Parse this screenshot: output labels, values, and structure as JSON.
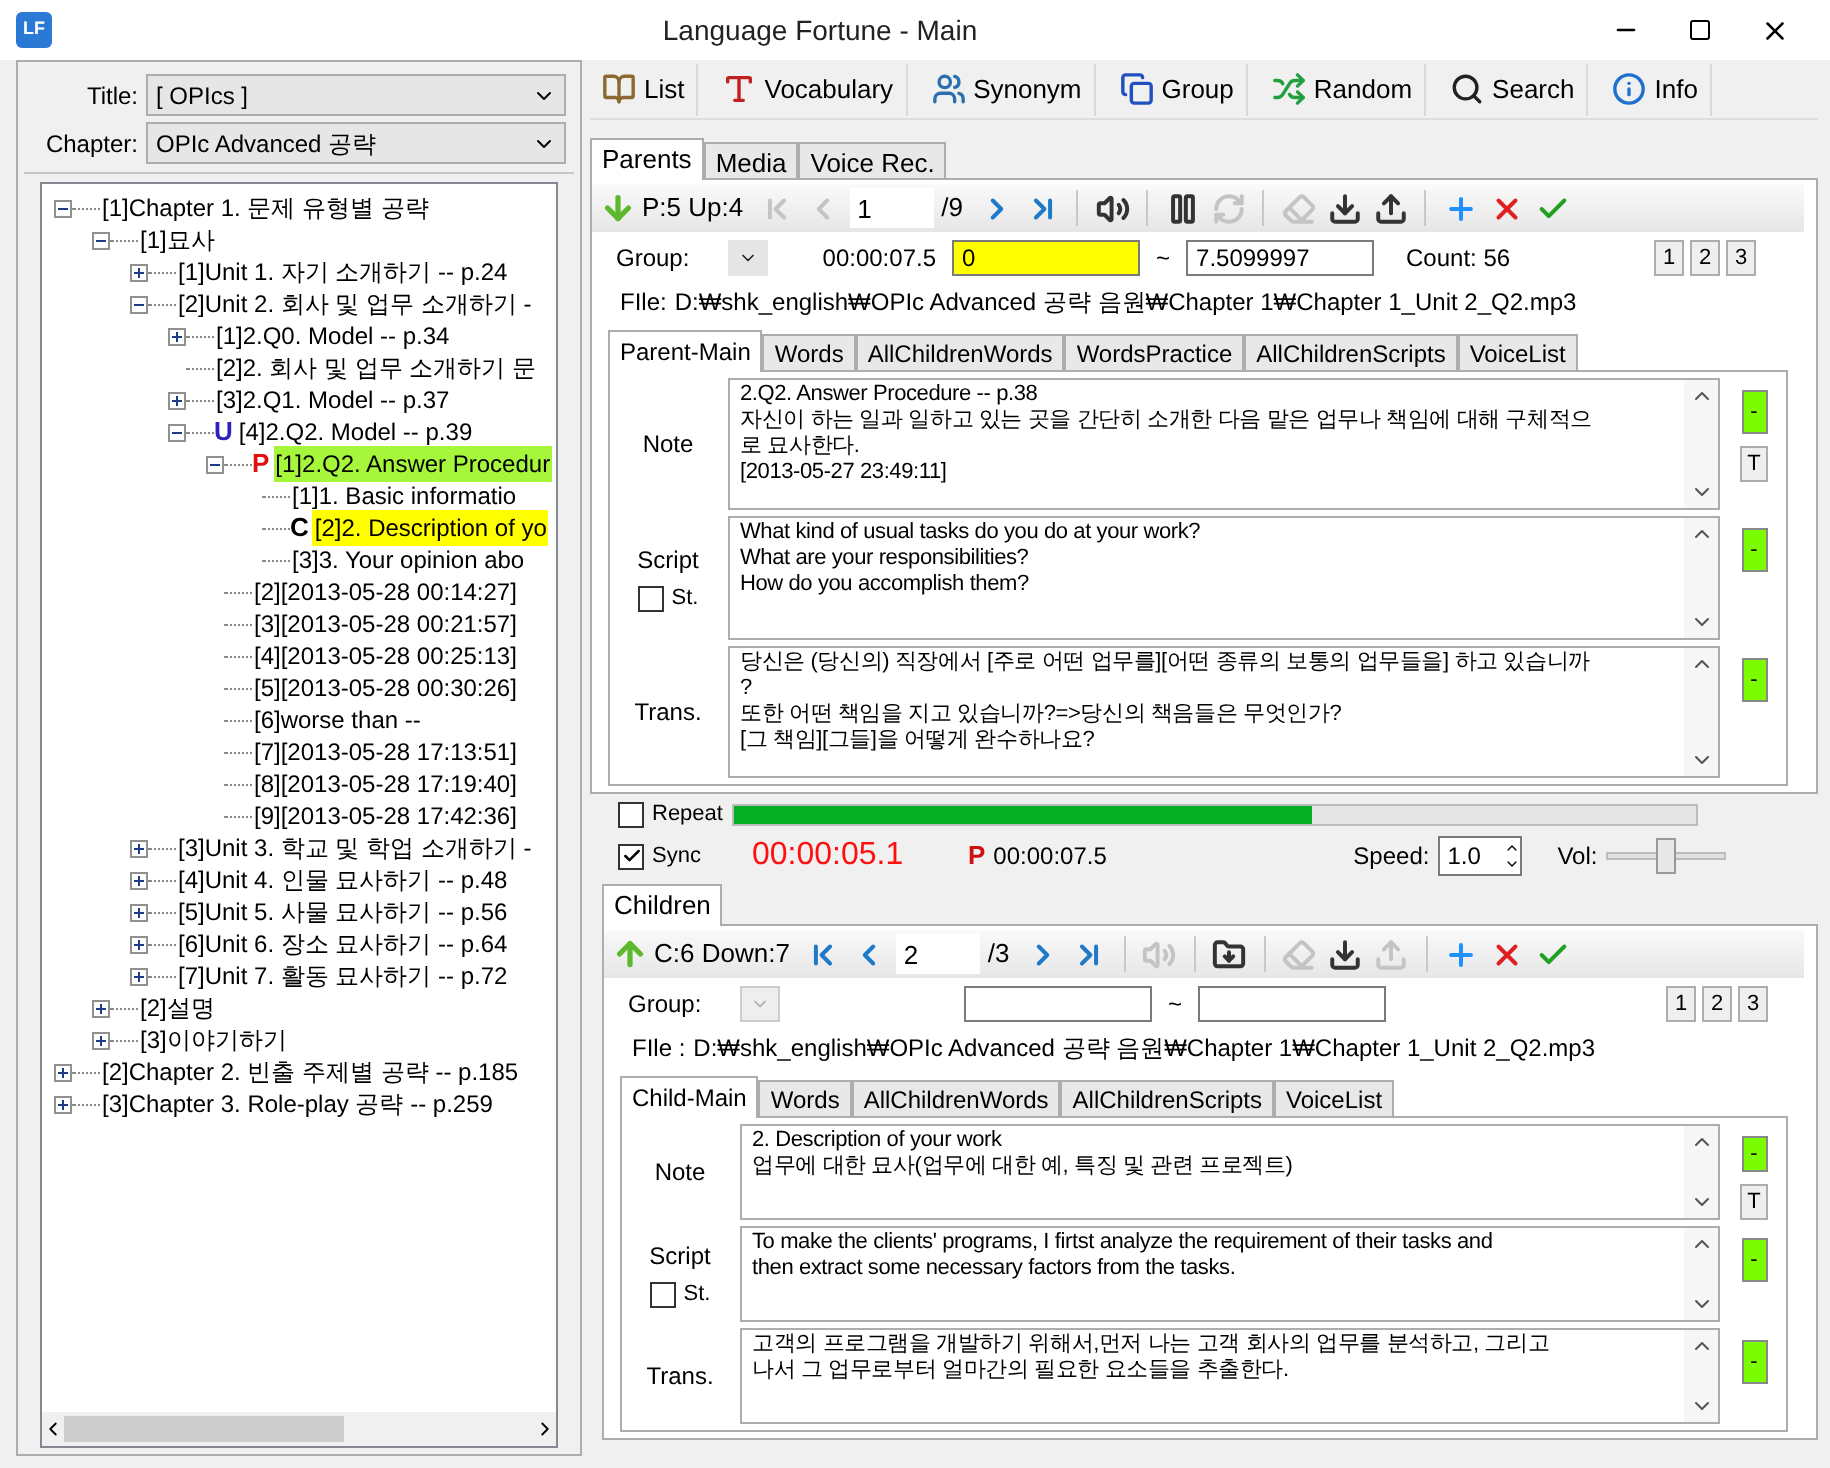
{
  "window": {
    "app_icon": "LF",
    "title": "Language Fortune - Main"
  },
  "left": {
    "title_label": "Title:",
    "title_value": "[ OPIcs ]",
    "chapter_label": "Chapter:",
    "chapter_value": "OPIc Advanced 공략",
    "tree": [
      {
        "label": "[1]Chapter 1. 문제 유형별 공략",
        "expanded": true,
        "children": [
          {
            "label": "[1]묘사",
            "expanded": true,
            "children": [
              {
                "label": "[1]Unit 1. 자기 소개하기 -- p.24",
                "expanded": false
              },
              {
                "label": "[2]Unit 2. 회사 및 업무 소개하기 -",
                "expanded": true,
                "children": [
                  {
                    "label": "[1]2.Q0. Model -- p.34",
                    "expanded": false
                  },
                  {
                    "label": "[2]2. 회사 및 업무 소개하기 문"
                  },
                  {
                    "label": "[3]2.Q1. Model -- p.37",
                    "expanded": false
                  },
                  {
                    "label": "[4]2.Q2. Model -- p.39",
                    "expanded": true,
                    "marker": "U",
                    "children": [
                      {
                        "label": "[1]2.Q2. Answer Procedur",
                        "expanded": true,
                        "marker": "P",
                        "color": "#a6f73c",
                        "children": [
                          {
                            "label": "[1]1. Basic informatio"
                          },
                          {
                            "label": "[2]2. Description of yo",
                            "marker": "C",
                            "color": "#ffff00"
                          },
                          {
                            "label": "[3]3. Your opinion abo"
                          }
                        ]
                      },
                      {
                        "label": "[2][2013-05-28 00:14:27]"
                      },
                      {
                        "label": "[3][2013-05-28 00:21:57]"
                      },
                      {
                        "label": "[4][2013-05-28 00:25:13]"
                      },
                      {
                        "label": "[5][2013-05-28 00:30:26]"
                      },
                      {
                        "label": "[6]worse than --"
                      },
                      {
                        "label": "[7][2013-05-28 17:13:51]"
                      },
                      {
                        "label": "[8][2013-05-28 17:19:40]"
                      },
                      {
                        "label": "[9][2013-05-28 17:42:36]"
                      }
                    ]
                  }
                ]
              },
              {
                "label": "[3]Unit 3. 학교 및 학업 소개하기 -",
                "expanded": false
              },
              {
                "label": "[4]Unit 4. 인물 묘사하기 -- p.48",
                "expanded": false
              },
              {
                "label": "[5]Unit 5. 사물 묘사하기 -- p.56",
                "expanded": false
              },
              {
                "label": "[6]Unit 6. 장소 묘사하기 -- p.64",
                "expanded": false
              },
              {
                "label": "[7]Unit 7. 활동 묘사하기 -- p.72",
                "expanded": false
              }
            ]
          },
          {
            "label": "[2]설명",
            "expanded": false
          },
          {
            "label": "[3]이야기하기",
            "expanded": false
          }
        ]
      },
      {
        "label": "[2]Chapter 2. 빈출 주제별 공략 -- p.185",
        "expanded": false
      },
      {
        "label": "[3]Chapter 3. Role-play 공략 -- p.259",
        "expanded": false
      }
    ]
  },
  "toolbar": [
    {
      "kind": "list",
      "label": "List"
    },
    {
      "kind": "vocabulary",
      "label": "Vocabulary"
    },
    {
      "kind": "synonym",
      "label": "Synonym"
    },
    {
      "kind": "group",
      "label": "Group"
    },
    {
      "kind": "random",
      "label": "Random"
    },
    {
      "kind": "search",
      "label": "Search"
    },
    {
      "kind": "info",
      "label": "Info"
    }
  ],
  "top_tabs": [
    {
      "label": "Parents",
      "selected": true
    },
    {
      "label": "Media",
      "selected": false
    },
    {
      "label": "Voice Rec.",
      "selected": false
    }
  ],
  "parent": {
    "nav": {
      "up": false,
      "status": "P:5 Up:4",
      "page": "1",
      "total": "/9",
      "controls": [
        {
          "kind": "first",
          "disabled": true
        },
        {
          "kind": "prev",
          "disabled": true
        },
        {
          "kind": "page"
        },
        {
          "kind": "next",
          "disabled": false
        },
        {
          "kind": "last",
          "disabled": false
        },
        {
          "kind": "separator"
        },
        {
          "kind": "sound",
          "disabled": false
        },
        {
          "kind": "separator"
        },
        {
          "kind": "pause",
          "disabled": false
        },
        {
          "kind": "repeat",
          "disabled": true
        },
        {
          "kind": "separator"
        },
        {
          "kind": "eraser",
          "disabled": true
        },
        {
          "kind": "download",
          "disabled": false
        },
        {
          "kind": "upload",
          "disabled": false
        },
        {
          "kind": "separator"
        },
        {
          "kind": "add",
          "disabled": false
        },
        {
          "kind": "delete",
          "disabled": false
        },
        {
          "kind": "confirm",
          "disabled": false
        }
      ]
    },
    "group": {
      "label": "Group:",
      "disabled": false,
      "time": "00:00:07.5",
      "start": {
        "value": "0",
        "highlighted": true
      },
      "tilde": "~",
      "end": {
        "value": "7.5099997",
        "highlighted": false
      },
      "count": "Count: 56",
      "buttons": [
        "1",
        "2",
        "3"
      ]
    },
    "file": {
      "label": "FIle:",
      "path": "D:₩shk_english₩OPIc Advanced 공략 음원₩Chapter 1₩Chapter 1_Unit 2_Q2.mp3"
    },
    "tabs": [
      {
        "label": "Parent-Main",
        "selected": true
      },
      {
        "label": "Words",
        "selected": false
      },
      {
        "label": "AllChildrenWords",
        "selected": false
      },
      {
        "label": "WordsPractice",
        "selected": false
      },
      {
        "label": "AllChildrenScripts",
        "selected": false
      },
      {
        "label": "VoiceList",
        "selected": false
      }
    ],
    "fields": [
      {
        "kind": "note",
        "label": "Note",
        "lines": [
          "2.Q2. Answer Procedure -- p.38",
          "자신이 하는 일과 일하고 있는 곳을 간단히 소개한 다음 맡은 업무나 책임에 대해 구체적으",
          "로 묘사한다.",
          "[2013-05-27 23:49:11]"
        ],
        "button": "-",
        "extra_button": "T"
      },
      {
        "kind": "script",
        "label": "Script",
        "checkbox": {
          "label": "St.",
          "checked": false
        },
        "lines": [
          "What kind of usual  tasks do you do at your work?",
          "What are your responsibilities?",
          "How do you accomplish them?"
        ],
        "button": "-"
      },
      {
        "kind": "trans",
        "label": "Trans.",
        "lines": [
          "당신은 (당신의) 직장에서 [주로 어떤 업무를][어떤 종류의 보통의 업무들을] 하고 있습니까",
          "?",
          "또한 어떤 책임을 지고 있습니까?=>당신의 책음들은 무엇인가?",
          "[그 책임][그들]을 어떻게 완수하나요?"
        ],
        "button": "-"
      }
    ]
  },
  "player": {
    "repeat": {
      "label": "Repeat",
      "checked": false
    },
    "progress": {
      "level": 0.6
    },
    "sync": {
      "label": "Sync",
      "checked": true
    },
    "elapsed": "00:00:05.1",
    "p_mark": "P",
    "p_time": "00:00:07.5",
    "speed_label": "Speed:",
    "speed": "1.0",
    "vol_label": "Vol:",
    "volume": {
      "level": 0.5
    }
  },
  "children_tabs": [
    {
      "label": "Children",
      "selected": true
    }
  ],
  "child": {
    "nav": {
      "up": true,
      "status": "C:6 Down:7",
      "page": "2",
      "total": "/3",
      "controls": [
        {
          "kind": "first",
          "disabled": false
        },
        {
          "kind": "prev",
          "disabled": false
        },
        {
          "kind": "page"
        },
        {
          "kind": "next",
          "disabled": false
        },
        {
          "kind": "last",
          "disabled": false
        },
        {
          "kind": "separator"
        },
        {
          "kind": "sound",
          "disabled": true
        },
        {
          "kind": "separator"
        },
        {
          "kind": "folder",
          "disabled": false
        },
        {
          "kind": "separator"
        },
        {
          "kind": "eraser",
          "disabled": true
        },
        {
          "kind": "download",
          "disabled": false
        },
        {
          "kind": "upload",
          "disabled": true
        },
        {
          "kind": "separator"
        },
        {
          "kind": "add",
          "disabled": false
        },
        {
          "kind": "delete",
          "disabled": false
        },
        {
          "kind": "confirm",
          "disabled": false
        }
      ]
    },
    "group": {
      "label": "Group:",
      "disabled": true,
      "start": {
        "highlighted": false
      },
      "tilde": "~",
      "end": {
        "highlighted": false
      },
      "buttons": [
        "1",
        "2",
        "3"
      ]
    },
    "file": {
      "label": "FIle :",
      "path": "D:₩shk_english₩OPIc Advanced 공략 음원₩Chapter 1₩Chapter 1_Unit 2_Q2.mp3"
    },
    "tabs": [
      {
        "label": "Child-Main",
        "selected": true
      },
      {
        "label": "Words",
        "selected": false
      },
      {
        "label": "AllChildrenWords",
        "selected": false
      },
      {
        "label": "AllChildrenScripts",
        "selected": false
      },
      {
        "label": "VoiceList",
        "selected": false
      }
    ],
    "fields": [
      {
        "kind": "note",
        "label": "Note",
        "lines": [
          "2. Description of your work",
          "업무에 대한 묘사(업무에 대한 예, 특징 및 관련 프로젝트)"
        ],
        "button": "-",
        "extra_button": "T"
      },
      {
        "kind": "script",
        "label": "Script",
        "checkbox": {
          "label": "St.",
          "checked": false
        },
        "lines": [
          "To make the clients' programs, I firtst analyze the requirement of their tasks and",
          "then extract some necessary factors from the tasks."
        ],
        "button": "-"
      },
      {
        "kind": "trans",
        "label": "Trans.",
        "lines": [
          "고객의 프로그램을 개발하기 위해서,먼저 나는 고객 회사의 업무를 분석하고, 그리고",
          "나서 그 업무로부터 얼마간의 필요한 요소들을 추출한다."
        ],
        "button": "-"
      }
    ]
  }
}
